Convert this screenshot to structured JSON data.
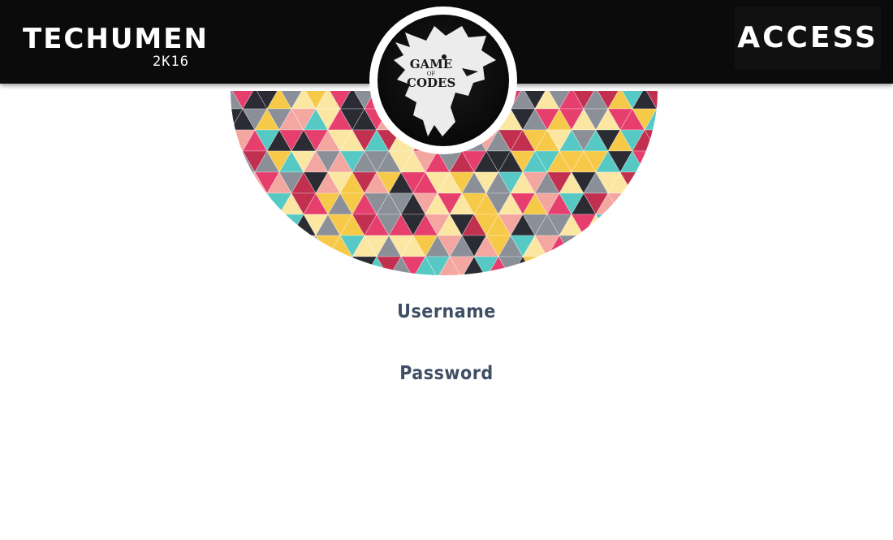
{
  "header": {
    "left_logo": {
      "name": "TECHUMEN",
      "year": "2K16"
    },
    "right_logo": {
      "text": "ACCESS"
    },
    "center_emblem": {
      "title_top": "GAME",
      "title_of": "OF",
      "title_bottom": "CODES",
      "icon": "wolf-sigil-icon"
    }
  },
  "form": {
    "username_label": "Username",
    "password_label": "Password"
  },
  "colors": {
    "topbar": "#0b0b0b",
    "label": "#3e4e63",
    "mosaic": [
      "#e63e6d",
      "#f7c948",
      "#57c9c4",
      "#2b2b33",
      "#f4a6a0",
      "#fbe6a2",
      "#8b8f98",
      "#c2304f"
    ]
  }
}
